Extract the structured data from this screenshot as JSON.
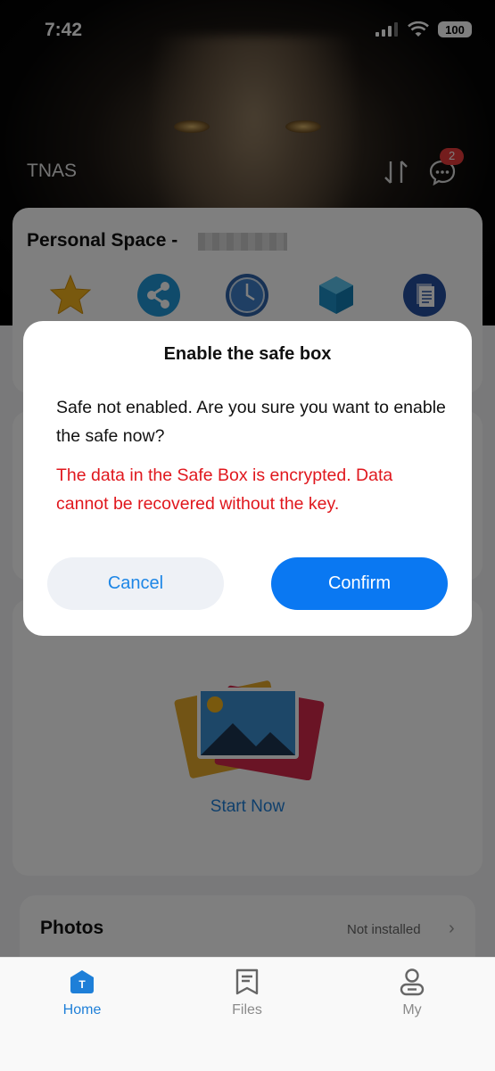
{
  "status_bar": {
    "time": "7:42",
    "battery": "100"
  },
  "header": {
    "app_name": "TNAS",
    "message_badge": "2"
  },
  "personal_space": {
    "title": "Personal Space -"
  },
  "photo_card": {
    "start_label": "Start Now"
  },
  "photos_section": {
    "title": "Photos",
    "status": "Not installed"
  },
  "dialog": {
    "title": "Enable the safe box",
    "message": "Safe not enabled. Are you sure you want to enable the safe now?",
    "warning": "The data in the Safe Box is encrypted. Data cannot be recovered without the key.",
    "cancel_label": "Cancel",
    "confirm_label": "Confirm"
  },
  "tabbar": {
    "items": [
      {
        "label": "Home",
        "icon": "home-icon"
      },
      {
        "label": "Files",
        "icon": "files-icon"
      },
      {
        "label": "My",
        "icon": "profile-icon"
      }
    ]
  },
  "colors": {
    "accent": "#0a78f2",
    "warning": "#e0171d",
    "link": "#1e7fd8"
  }
}
